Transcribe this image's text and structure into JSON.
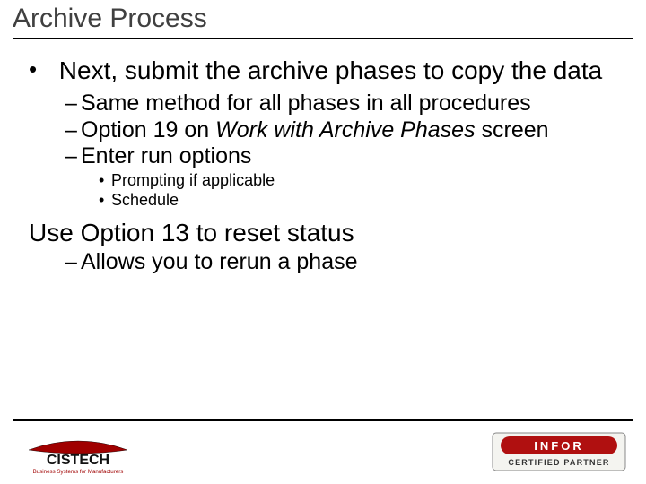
{
  "title": "Archive Process",
  "b1": "Next, submit the archive phases to copy the data",
  "s1": "Same method for all phases in all procedures",
  "s2a": "Option 19 on ",
  "s2b": "Work with Archive Phases",
  "s2c": " screen",
  "s3": "Enter run options",
  "t1": "Prompting if applicable",
  "t2": "Schedule",
  "b2": "Use Option 13 to reset status",
  "s4": "Allows you to rerun a phase",
  "logoLeft": {
    "name": "CISTECH",
    "tag": "Business Systems for Manufacturers"
  },
  "logoRight": {
    "name": "INFOR",
    "tag": "CERTIFIED PARTNER"
  }
}
